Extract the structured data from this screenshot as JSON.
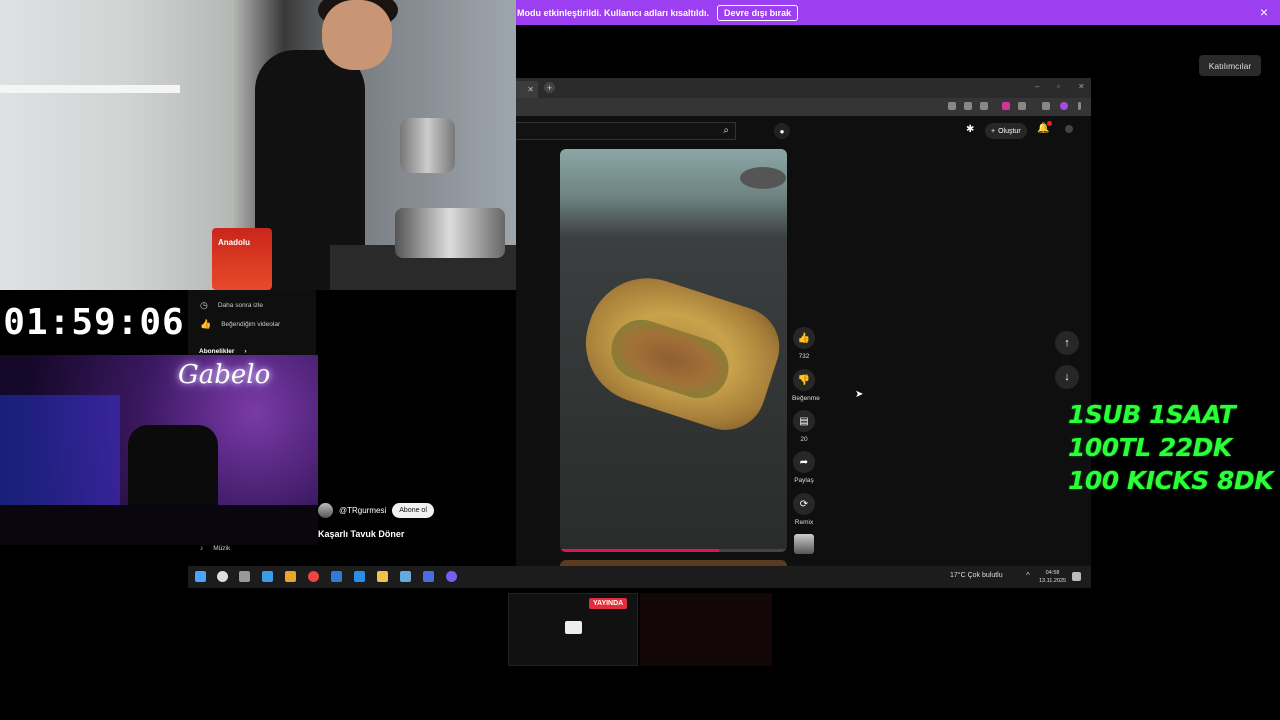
{
  "banner": {
    "message": "Modu etkinleştirildi. Kullanıcı adları kısaltıldı.",
    "disable_label": "Devre dışı bırak",
    "close_icon": "×"
  },
  "participants_label": "Katılımcılar",
  "browser": {
    "create_label": "Oluştur",
    "channel_handle": "@TRgurmesi",
    "subscribe_label": "Abone ol",
    "video_title": "Kaşarlı Tavuk Döner",
    "actions": {
      "like_count": "732",
      "dislike_label": "Beğenme",
      "comment_count": "20",
      "share_label": "Paylaş",
      "remix_label": "Remix"
    },
    "side_menu": {
      "watch_later": "Daha sonra izle",
      "liked_videos": "Beğendiğim videolar",
      "subscriptions": "Abonelikler",
      "music": "Müzik"
    }
  },
  "taskbar": {
    "weather": "17°C  Çok bulutlu",
    "time": "04:58",
    "date": "13.11.2025"
  },
  "timer": "01:59:06",
  "neon_sign": "Gabelo",
  "can_label": "Anadolu",
  "goals": [
    "1SUB 1SAAT",
    "100TL 22DK",
    "100 KICKS 8DK"
  ],
  "live_badge": "YAYINDA",
  "colors": {
    "banner": "#9b3ff0",
    "goal_text": "#2aff3a",
    "live_badge": "#e22d3a",
    "yt_progress": "#e3134e"
  },
  "icons": [
    "close-icon",
    "search-icon",
    "mic-icon",
    "plus-icon",
    "bell-icon",
    "like-icon",
    "dislike-icon",
    "comment-icon",
    "share-icon",
    "remix-icon",
    "arrow-up-icon",
    "arrow-down-icon",
    "clock-icon",
    "thumbs-up-icon",
    "windows-icon"
  ]
}
